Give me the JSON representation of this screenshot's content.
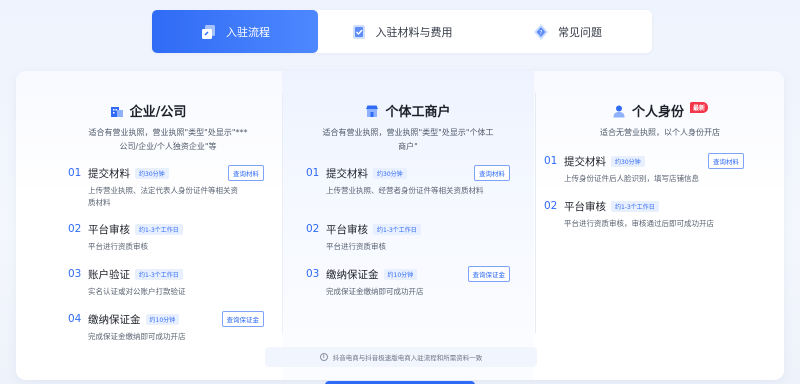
{
  "tabs": [
    {
      "label": "入驻流程",
      "icon": "process-icon",
      "active": true
    },
    {
      "label": "入驻材料与费用",
      "icon": "checklist-icon",
      "active": false
    },
    {
      "label": "常见问题",
      "icon": "question-icon",
      "active": false
    }
  ],
  "columns": [
    {
      "title": "企业/公司",
      "icon": "building-icon",
      "desc": "适合有营业执照，营业执照\"类型\"处显示\"***公司/企业/个人独资企业\"等",
      "steps": [
        {
          "num": "01",
          "title": "提交材料",
          "time": "约30分钟",
          "button": "查询材料",
          "desc": "上传营业执照、法定代表人身份证件等相关资质材料"
        },
        {
          "num": "02",
          "title": "平台审核",
          "time": "约1-3个工作日",
          "desc": "平台进行资质审核"
        },
        {
          "num": "03",
          "title": "账户验证",
          "time": "约1-3个工作日",
          "desc": "实名认证或对公账户打款验证"
        },
        {
          "num": "04",
          "title": "缴纳保证金",
          "time": "约10分钟",
          "button": "查询保证金",
          "desc": "完成保证金缴纳即可成功开店"
        }
      ]
    },
    {
      "title": "个体工商户",
      "icon": "shop-icon",
      "desc": "适合有营业执照，营业执照\"类型\"处显示\"个体工商户\"",
      "steps": [
        {
          "num": "01",
          "title": "提交材料",
          "time": "约30分钟",
          "button": "查询材料",
          "desc": "上传营业执照、经营者身份证件等相关资质材料"
        },
        {
          "num": "02",
          "title": "平台审核",
          "time": "约1-3个工作日",
          "desc": "平台进行资质审核"
        },
        {
          "num": "03",
          "title": "缴纳保证金",
          "time": "约10分钟",
          "button": "查询保证金",
          "desc": "完成保证金缴纳即可成功开店"
        }
      ]
    },
    {
      "title": "个人身份",
      "icon": "person-icon",
      "badge": "最新",
      "desc": "适合无营业执照，以个人身份开店",
      "steps": [
        {
          "num": "01",
          "title": "提交材料",
          "time": "约30分钟",
          "button": "查询材料",
          "desc": "上传身份证件后人脸识别，填写店铺信息"
        },
        {
          "num": "02",
          "title": "平台审核",
          "time": "约1-3个工作日",
          "desc": "平台进行资质审核，审核通过后即可成功开店"
        }
      ]
    }
  ],
  "notice": "抖音电商与抖音极速版电商入驻流程和所需资料一致",
  "colors": {
    "accent": "#2f6bf5",
    "badge": "#f5364a"
  }
}
